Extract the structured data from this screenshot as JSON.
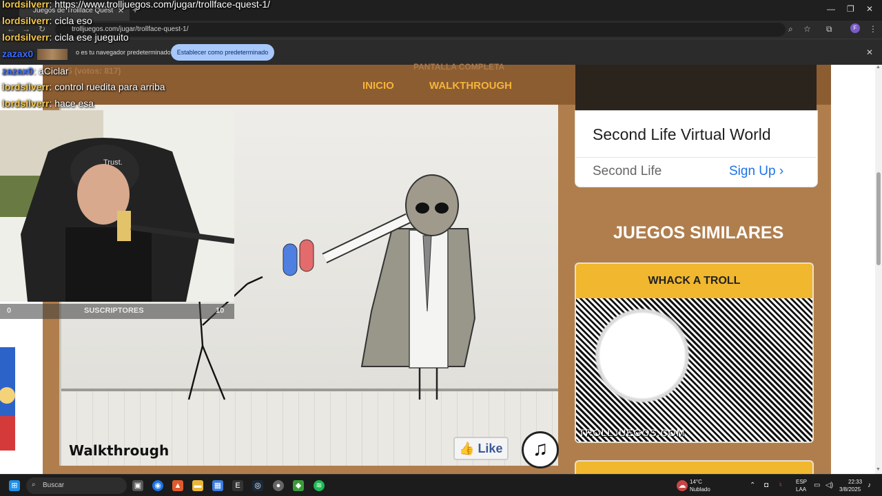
{
  "browser": {
    "tab_title": "Juegos de Trollface Quest",
    "url": "trolljuegos.com/jugar/trollface-quest-1/",
    "infobar_message": "o es tu navegador predeterminado",
    "infobar_button": "Establecer como predeterminado"
  },
  "chat": [
    {
      "user": "lordsilverr",
      "message": "https://www.trolljuegos.com/jugar/trollface-quest-1/"
    },
    {
      "user": "lordsilverr",
      "message": "cicla eso"
    },
    {
      "user": "lordsilverr",
      "message": "cicla ese jueguito"
    },
    {
      "user": "zazax0",
      "message": ""
    },
    {
      "user": "zazax0",
      "message": "aCiclar"
    },
    {
      "user": "lordsilverr",
      "message": "control ruedita para arriba"
    },
    {
      "user": "lordsilverr",
      "message": "hace esa"
    }
  ],
  "site": {
    "nav": {
      "home": "INICIO",
      "walkthrough": "WALKTHROUGH"
    },
    "faded_rating": "5.5 (votos: 817)",
    "faded_fullscreen": "PANTALLA COMPLETA"
  },
  "webcam": {
    "left_count": "0",
    "label": "SUSCRIPTORES",
    "right_count": "10",
    "shirt_brand": "Trust."
  },
  "game": {
    "walkthrough_label": "Walkthrough",
    "like_label": "Like",
    "music_icon": "music-note-icon"
  },
  "ad": {
    "title": "Second Life Virtual World",
    "brand": "Second Life",
    "cta": "Sign Up"
  },
  "similar": {
    "title": "JUEGOS SIMILARES",
    "cards": [
      {
        "title": "WHACK A TROLL",
        "caption": "TROLLJUEGOS.COM"
      }
    ]
  },
  "taskbar": {
    "search_placeholder": "Buscar",
    "weather_temp": "14°C",
    "weather_desc": "Nublado",
    "lang_1": "ESP",
    "lang_2": "LAA",
    "time": "22:33",
    "date": "3/8/2025"
  },
  "colors": {
    "accent_orange": "#f5b43a",
    "page_bg": "#b07e4d",
    "card_head": "#f0b72f",
    "link_blue": "#1a73e8"
  }
}
